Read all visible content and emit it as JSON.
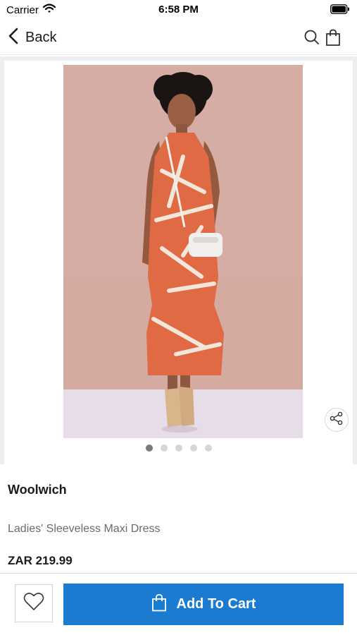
{
  "status_bar": {
    "carrier": "Carrier",
    "time": "6:58 PM"
  },
  "nav": {
    "back_label": "Back",
    "icons": [
      "chevron-left-icon",
      "search-icon",
      "shopping-bag-icon"
    ]
  },
  "gallery": {
    "image_count": 5,
    "active_index": 0,
    "share_icon": "share-icon"
  },
  "product": {
    "brand": "Woolwich",
    "name": "Ladies' Sleeveless Maxi Dress",
    "price": "ZAR 219.99"
  },
  "actions": {
    "wishlist_icon": "heart-icon",
    "add_to_cart_label": "Add To Cart"
  },
  "colors": {
    "accent": "#1a7bd0",
    "photo_backdrop": "#d6ada4",
    "dress": "#e06a43"
  }
}
